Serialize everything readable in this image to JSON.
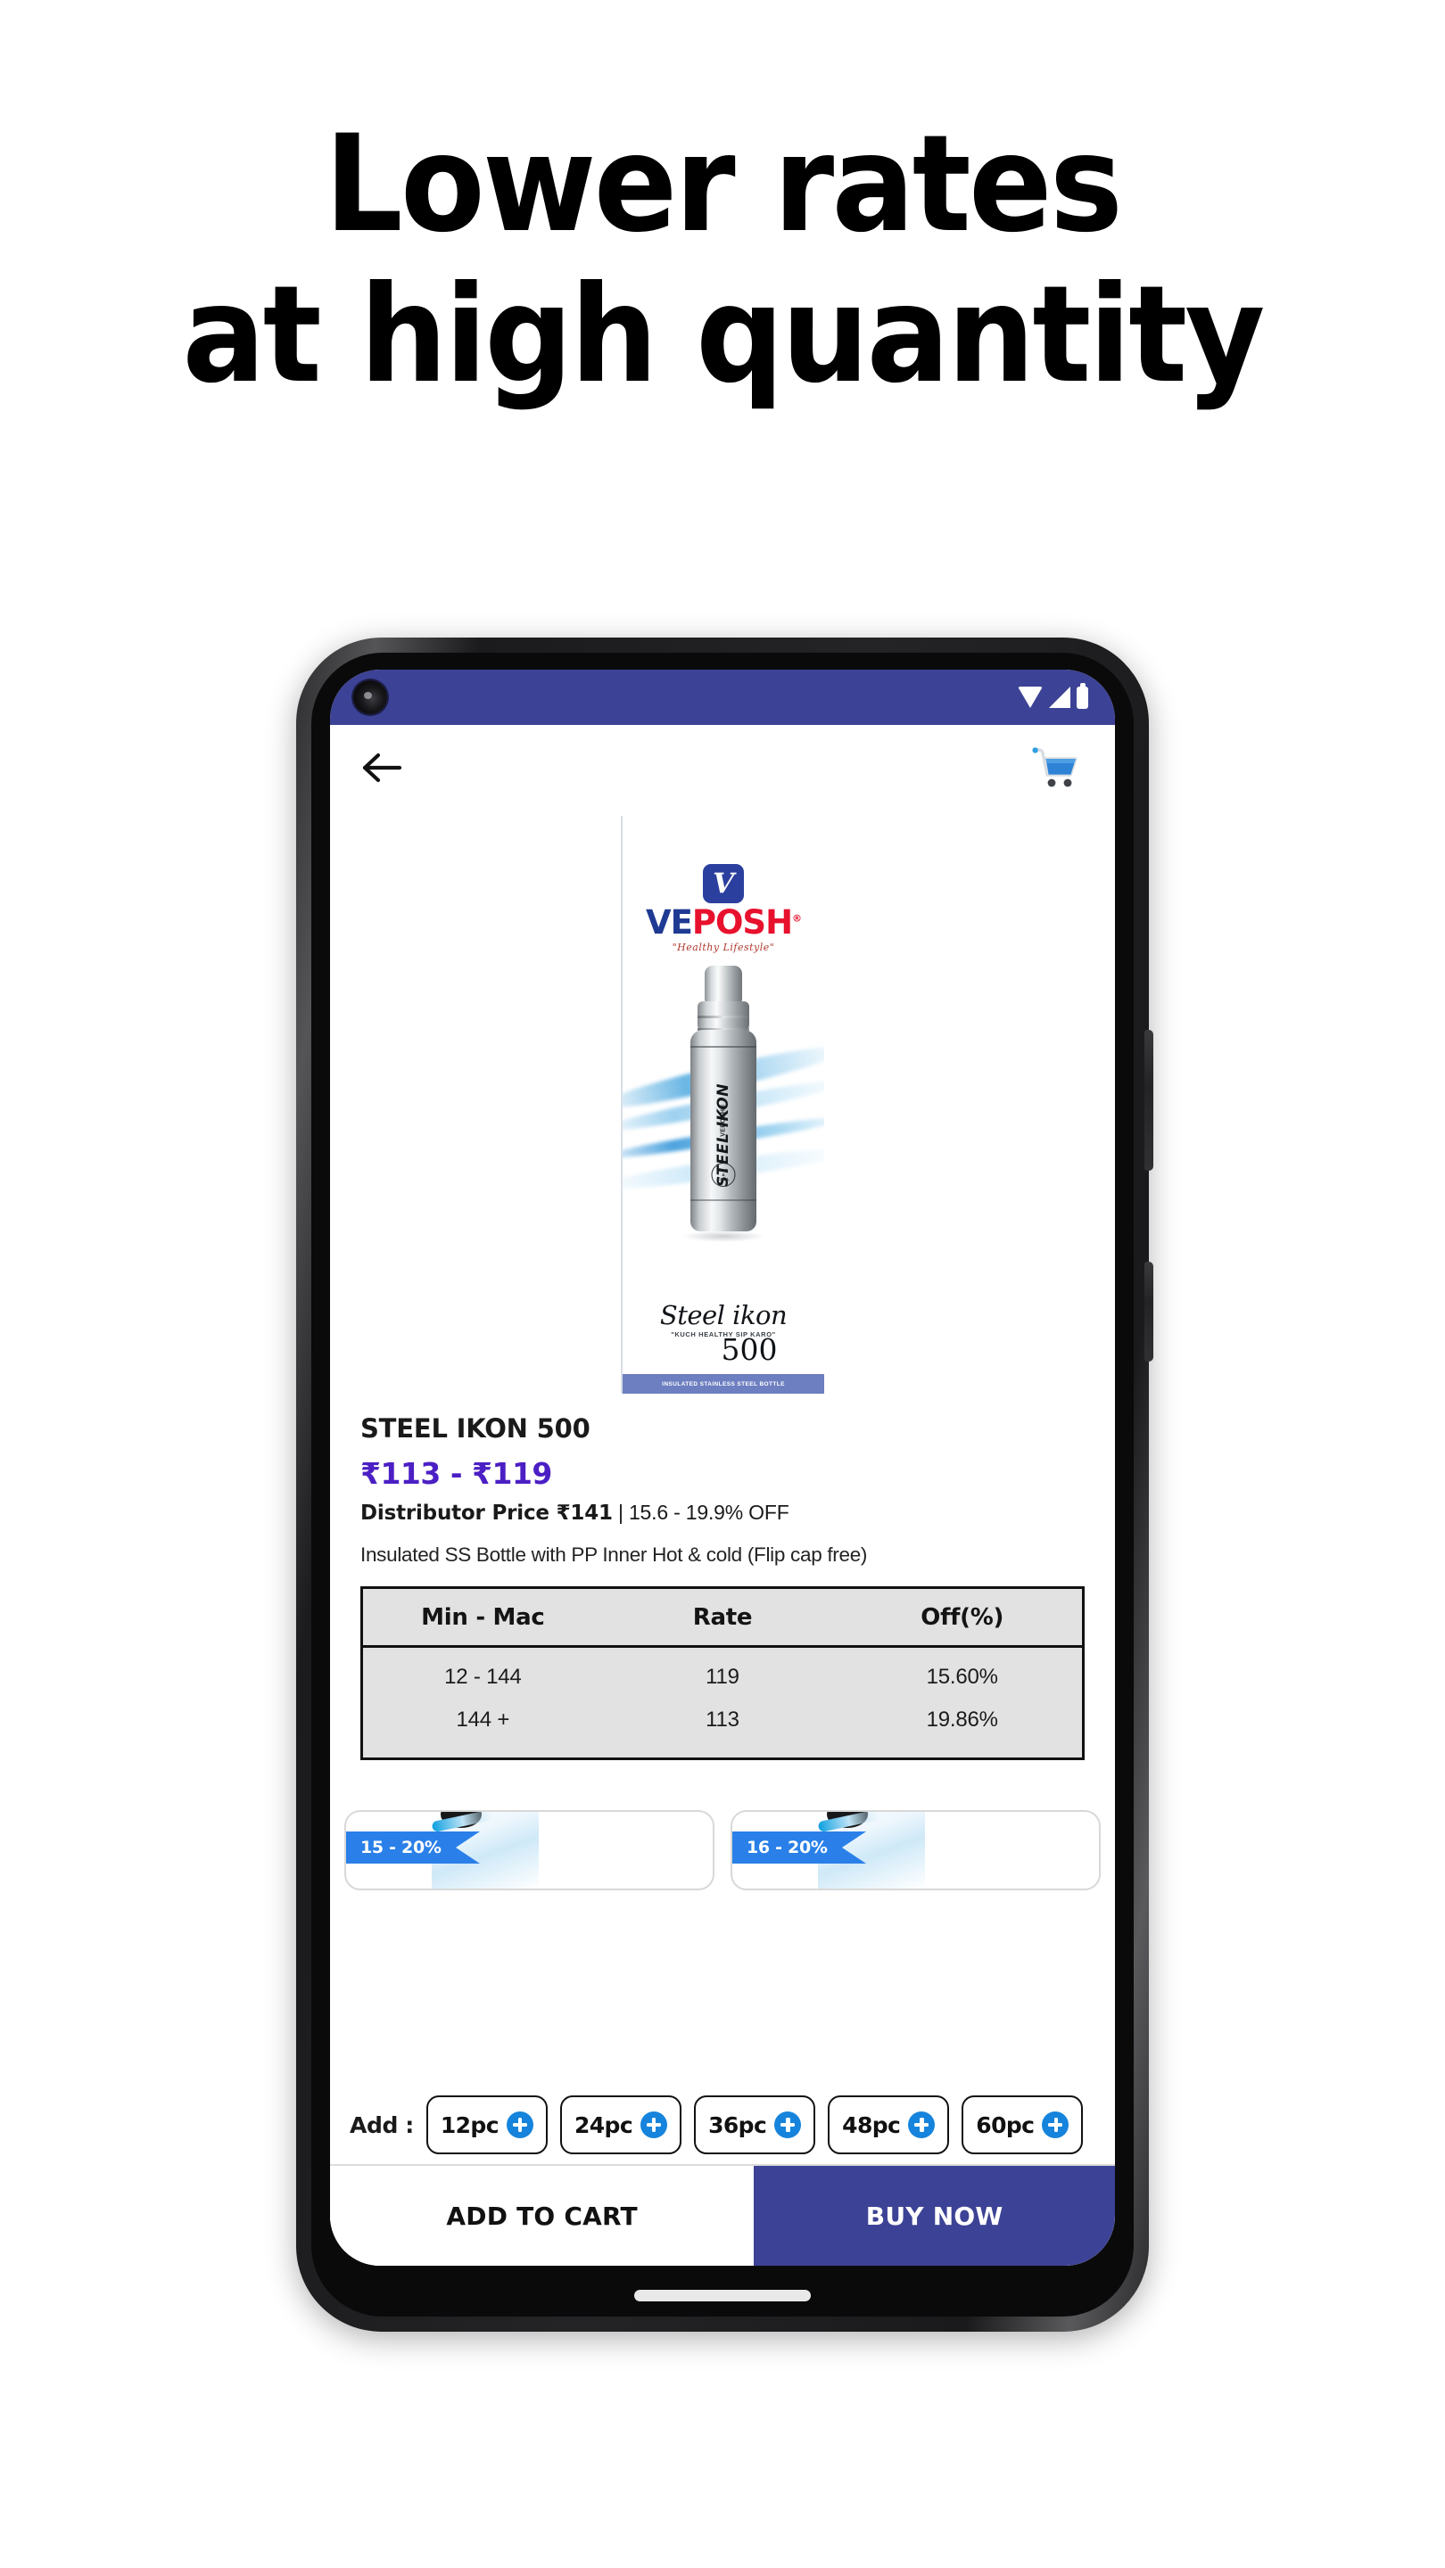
{
  "headline": {
    "line1": "Lower rates",
    "line2": "at high quantity"
  },
  "phone": {
    "status_bar": {
      "background": "#3c4295",
      "icons": [
        "wifi-icon",
        "signal-icon",
        "battery-icon"
      ]
    },
    "app_bar": {
      "back_icon": "back-arrow-icon",
      "cart_icon": "shopping-cart-icon"
    }
  },
  "hero": {
    "brand": {
      "mark_letter": "V",
      "word_part1": "VE",
      "word_part2": "POSH",
      "registered": "®",
      "tagline": "\"Healthy Lifestyle\""
    },
    "bottle": {
      "label": "STEEL IKON",
      "mini_logo": "VEPOSH®",
      "hot": "HOT",
      "amp": "&",
      "cool": "COOL"
    },
    "caption": {
      "script": "Steel ikon",
      "tagline": "\"KUCH HEALTHY SIP KARO\"",
      "volume": "500",
      "footbar": "INSULATED STAINLESS STEEL BOTTLE"
    }
  },
  "product": {
    "title": "STEEL IKON 500",
    "price_range": "₹113 - ₹119",
    "distributor_label": "Distributor Price ₹141",
    "discount_text": " | 15.6 - 19.9% OFF",
    "description": "Insulated SS Bottle with PP Inner Hot & cold (Flip cap free)",
    "price_color": "#4b1fc4"
  },
  "rate_table": {
    "headers": [
      "Min - Mac",
      "Rate",
      "Off(%)"
    ],
    "rows": [
      {
        "range": "12 - 144",
        "rate": "119",
        "off": "15.60%"
      },
      {
        "range": "144 +",
        "rate": "113",
        "off": "19.86%"
      }
    ]
  },
  "suggestions": [
    {
      "badge": "15 - 20%"
    },
    {
      "badge": "16 - 20%"
    }
  ],
  "add_row": {
    "label": "Add :",
    "chips": [
      {
        "label": "12pc",
        "icon": "plus-icon"
      },
      {
        "label": "24pc",
        "icon": "plus-icon"
      },
      {
        "label": "36pc",
        "icon": "plus-icon"
      },
      {
        "label": "48pc",
        "icon": "plus-icon"
      },
      {
        "label": "60pc",
        "icon": "plus-icon"
      }
    ]
  },
  "bottom_bar": {
    "add_to_cart": "ADD TO CART",
    "buy_now": "BUY NOW",
    "buy_now_color": "#3c4295"
  }
}
